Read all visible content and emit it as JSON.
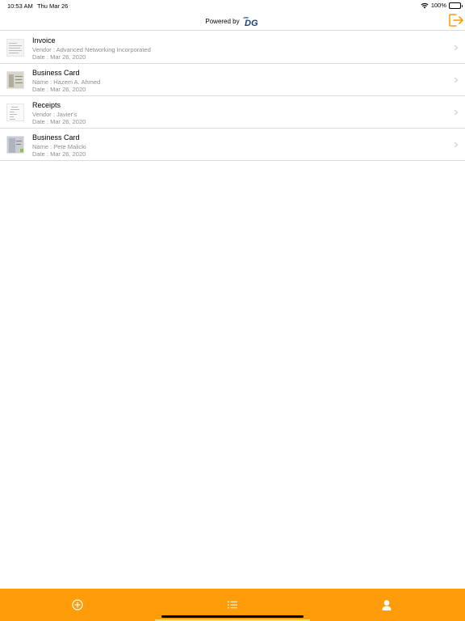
{
  "status_bar": {
    "time": "10:53 AM",
    "date": "Thu Mar 26",
    "battery": "100%"
  },
  "header": {
    "powered_by": "Powered by",
    "logo_text": "DG",
    "logout_icon": "logout-icon"
  },
  "colors": {
    "accent": "#ff9c0a",
    "text_secondary": "#8e8e93",
    "divider": "#dcdcdc"
  },
  "documents": [
    {
      "title": "Invoice",
      "detail": "Vendor : Advanced Networking Incorporated",
      "date": "Date : Mar 26, 2020"
    },
    {
      "title": "Business Card",
      "detail": "Name : Hazem A. Ahmed",
      "date": "Date : Mar 26, 2020"
    },
    {
      "title": "Receipts",
      "detail": "Vendor : Javier's",
      "date": "Date : Mar 26, 2020"
    },
    {
      "title": "Business Card",
      "detail": "Name : Pete Malicki",
      "date": "Date : Mar 26, 2020"
    }
  ],
  "tabbar": {
    "tabs": [
      "add-icon",
      "list-icon",
      "profile-icon"
    ],
    "selected": "list-icon"
  }
}
